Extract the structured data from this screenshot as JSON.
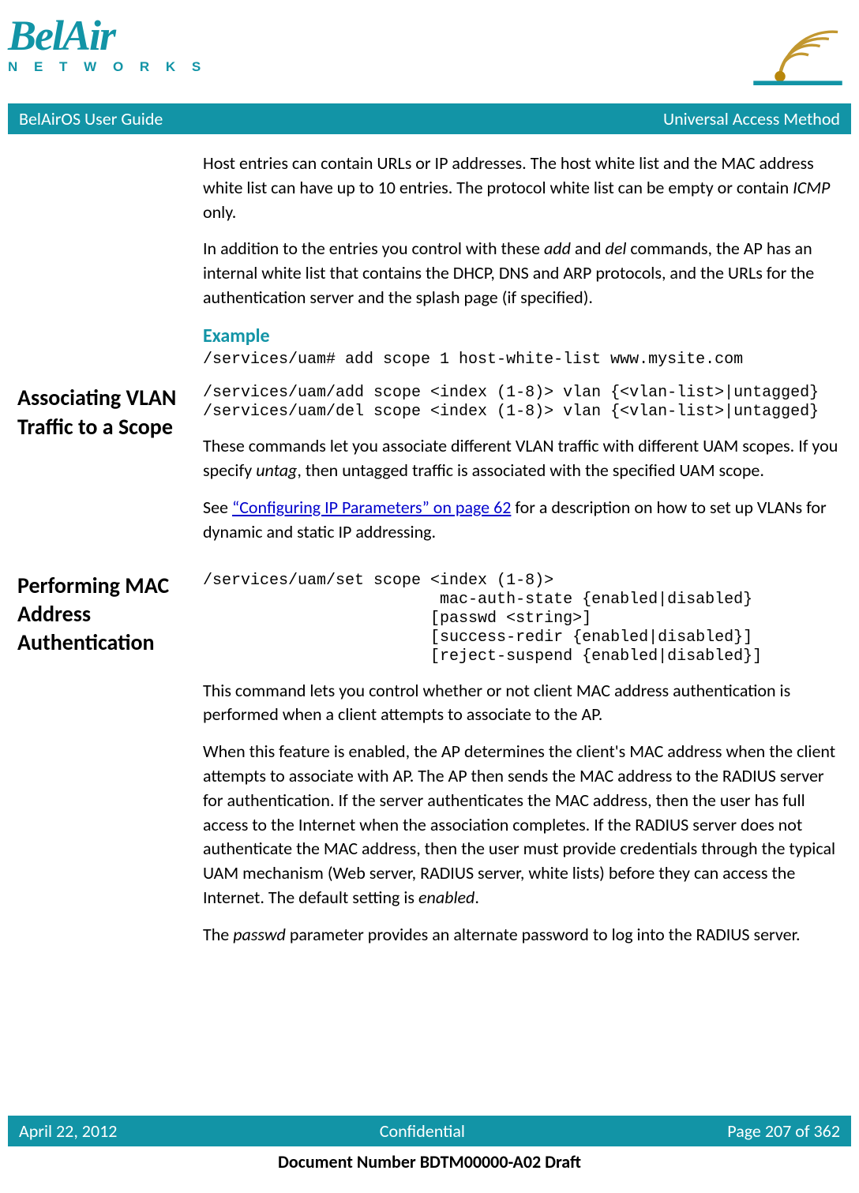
{
  "logo": {
    "brand": "BelAir",
    "subtitle": "N E T W O R K S"
  },
  "banner": {
    "left": "BelAirOS User Guide",
    "right": "Universal Access Method"
  },
  "s1": {
    "p1a": "Host entries can contain URLs or IP addresses. The host white list and the MAC address white list can have up to 10 entries. The protocol white list can be empty or contain ",
    "p1_icmp": "ICMP",
    "p1b": " only.",
    "p2a": "In addition to the entries you control with these ",
    "p2_add": "add",
    "p2b": " and ",
    "p2_del": "del",
    "p2c": " commands, the AP has an internal white list that contains the DHCP, DNS and ARP protocols, and the URLs for the authentication server and the splash page (if specified).",
    "example_label": "Example",
    "example_code": "/services/uam# add scope 1 host-white-list www.mysite.com"
  },
  "s2": {
    "heading": "Associating VLAN Traffic to a Scope",
    "code": "/services/uam/add scope <index (1-8)> vlan {<vlan-list>|untagged}\n/services/uam/del scope <index (1-8)> vlan {<vlan-list>|untagged}",
    "p1a": "These commands let you associate different VLAN traffic with different UAM scopes. If you specify ",
    "p1_untag": "untag",
    "p1b": ", then untagged traffic is associated with the specified UAM scope.",
    "p2a": "See ",
    "p2_link": "“Configuring IP Parameters” on page 62",
    "p2b": " for a description on how to set up VLANs for dynamic and static IP addressing."
  },
  "s3": {
    "heading": "Performing MAC Address Authentication",
    "code": "/services/uam/set scope <index (1-8)>\n                         mac-auth-state {enabled|disabled}\n                        [passwd <string>]\n                        [success-redir {enabled|disabled}]\n                        [reject-suspend {enabled|disabled}]",
    "p1": "This command lets you control whether or not client MAC address authentication is performed when a client attempts to associate to the AP.",
    "p2a": "When this feature is enabled, the AP determines the client's MAC address when the client attempts to associate with AP. The AP then sends the MAC address to the RADIUS server for authentication. If the server authenticates the MAC address, then the user has full access to the Internet when the association completes. If the RADIUS server does not authenticate the MAC address, then the user must provide credentials through the typical UAM mechanism (Web server, RADIUS server, white lists) before they can access the Internet. The default setting is ",
    "p2_enabled": "enabled",
    "p2b": ".",
    "p3a": "The ",
    "p3_passwd": "passwd",
    "p3b": " parameter provides an alternate password to log into the RADIUS server."
  },
  "footer": {
    "date": "April 22, 2012",
    "confidential": "Confidential",
    "page": "Page 207 of 362",
    "docnum": "Document Number BDTM00000-A02 Draft"
  }
}
